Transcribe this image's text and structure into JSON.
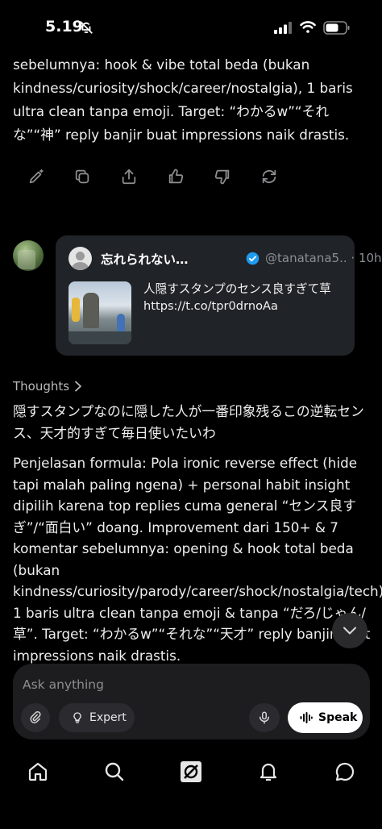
{
  "status": {
    "time": "5.19"
  },
  "message_top": {
    "text": "sebelumnya: hook & vibe total beda (bukan kindness/curiosity/shock/career/nostalgia), 1 baris ultra clean tanpa emoji. Target: “わかるw”“それな”“神” reply banjir buat impressions naik drastis."
  },
  "message_actions": [
    "edit-icon",
    "copy-icon",
    "share-icon",
    "thumbs-up-icon",
    "thumbs-down-icon",
    "regenerate-icon"
  ],
  "tweet": {
    "name": "忘れられない…",
    "handle": "@tanatana5..",
    "time": "· 10h",
    "text": "人隠すスタンプのセンス良すぎて草 https://t.co/tpr0drnoAa"
  },
  "thoughts": {
    "label": "Thoughts"
  },
  "reply_jp": "隠すスタンプなのに隠した人が一番印象残るこの逆転センス、天才的すぎて毎日使いたいわ",
  "explanation": "Penjelasan formula: Pola ironic reverse effect (hide tapi malah paling ngena) + personal habit insight dipilih karena top replies cuma general “センス良すぎ”/“面白い” doang. Improvement dari 150+ & 7 komentar sebelumnya: opening & hook total beda (bukan kindness/curiosity/parody/career/shock/nostalgia/tech), 1 baris ultra clean tanpa emoji & tanpa “だろ/じゃん/草”. Target: “わかるw”“それな”“天才” reply banjir buat impressions naik drastis.",
  "composer": {
    "placeholder": "Ask anything",
    "expert_label": "Expert",
    "speak_label": "Speak"
  },
  "colors": {
    "background": "#000000",
    "card": "#202327",
    "composer": "#1d1d20",
    "verified": "#1d9bf0"
  }
}
